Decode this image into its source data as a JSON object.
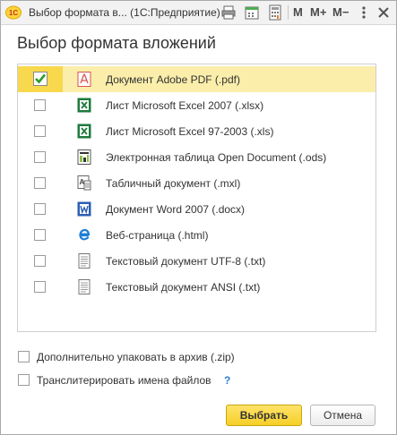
{
  "window": {
    "title": "Выбор формата в...",
    "app_name": "(1С:Предприятие)",
    "app_logo_text": "1С",
    "toolbar": {
      "m_label": "M",
      "m_plus_label": "M+",
      "m_minus_label": "M−"
    }
  },
  "heading": "Выбор формата вложений",
  "formats": [
    {
      "label": "Документ Adobe PDF (.pdf)",
      "checked": true,
      "selected": true,
      "icon": "pdf-icon"
    },
    {
      "label": "Лист Microsoft Excel 2007 (.xlsx)",
      "checked": false,
      "selected": false,
      "icon": "excel-icon"
    },
    {
      "label": "Лист Microsoft Excel 97-2003 (.xls)",
      "checked": false,
      "selected": false,
      "icon": "excel-icon"
    },
    {
      "label": "Электронная таблица Open Document (.ods)",
      "checked": false,
      "selected": false,
      "icon": "ods-icon"
    },
    {
      "label": "Табличный документ (.mxl)",
      "checked": false,
      "selected": false,
      "icon": "mxl-icon"
    },
    {
      "label": "Документ Word 2007 (.docx)",
      "checked": false,
      "selected": false,
      "icon": "word-icon"
    },
    {
      "label": "Веб-страница (.html)",
      "checked": false,
      "selected": false,
      "icon": "web-icon"
    },
    {
      "label": "Текстовый документ UTF-8 (.txt)",
      "checked": false,
      "selected": false,
      "icon": "text-icon"
    },
    {
      "label": "Текстовый документ ANSI (.txt)",
      "checked": false,
      "selected": false,
      "icon": "text-icon"
    }
  ],
  "options": {
    "zip_label": "Дополнительно упаковать в архив (.zip)",
    "zip_checked": false,
    "transliterate_label": "Транслитерировать имена файлов",
    "transliterate_checked": false,
    "help_label": "?"
  },
  "buttons": {
    "ok_label": "Выбрать",
    "cancel_label": "Отмена"
  },
  "colors": {
    "selected_row": "#fbeeab",
    "selected_marker": "#f8d84c",
    "primary_button": "#f5cf26",
    "help": "#2b7fd1"
  }
}
